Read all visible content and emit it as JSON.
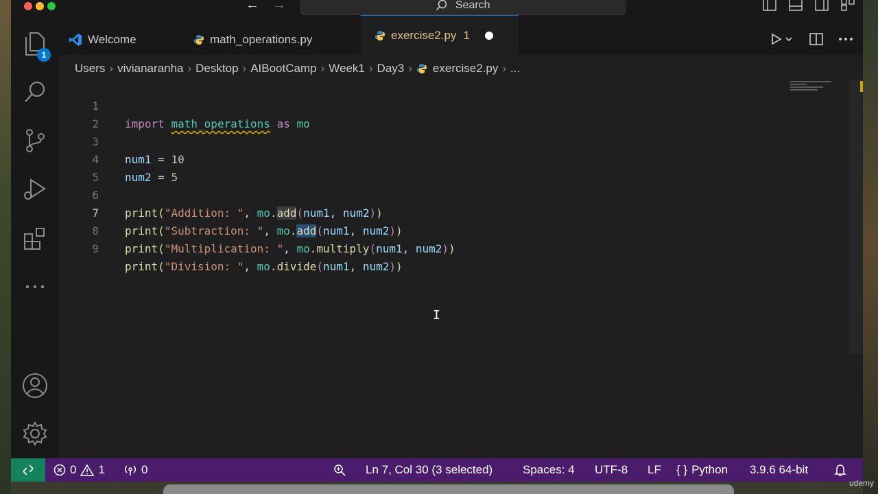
{
  "window": {
    "search_label": "Search"
  },
  "activity_bar": {
    "explorer_badge": "1"
  },
  "tabs": [
    {
      "label": "Welcome"
    },
    {
      "label": "math_operations.py"
    },
    {
      "label": "exercise2.py",
      "problem_count": "1"
    }
  ],
  "breadcrumbs": [
    "Users",
    "vivianaranha",
    "Desktop",
    "AIBootCamp",
    "Week1",
    "Day3",
    "exercise2.py",
    "..."
  ],
  "editor": {
    "active_line": 7,
    "line_numbers": [
      "1",
      "2",
      "3",
      "4",
      "5",
      "6",
      "7",
      "8",
      "9"
    ]
  },
  "statusbar": {
    "errors": "0",
    "warnings": "1",
    "ports": "0",
    "position": "Ln 7, Col 30 (3 selected)",
    "spaces": "Spaces: 4",
    "encoding": "UTF-8",
    "eol": "LF",
    "language": "Python",
    "interpreter": "3.9.6 64-bit"
  },
  "watermark": "udemy",
  "colors": {
    "statusbar": "#4b1c6b",
    "remote": "#16825d",
    "accent": "#0078d4",
    "modified_tab": "#e2c08d"
  }
}
